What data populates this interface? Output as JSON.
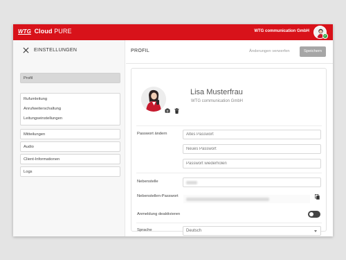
{
  "topbar": {
    "logo_brand": "WTG",
    "logo_product": "Cloud",
    "logo_edition": "PURE",
    "company": "WTG communication GmbH",
    "status_mark": "✓"
  },
  "sidebar": {
    "title": "EINSTELLUNGEN",
    "items": [
      {
        "label": "Profil",
        "active": true
      },
      {
        "label": "Rufumleitung"
      },
      {
        "label": "Anrufweiterschaltung"
      },
      {
        "label": "Leitungseinstellungen"
      },
      {
        "label": "Mitteilungen"
      },
      {
        "label": "Audio"
      },
      {
        "label": "Client-Informationen"
      },
      {
        "label": "Logs"
      }
    ]
  },
  "main": {
    "title": "PROFIL",
    "discard_label": "Änderungen verwerfen",
    "save_label": "Speichern",
    "profile": {
      "name": "Lisa Musterfrau",
      "company": "WTG communication GmbH"
    },
    "password": {
      "label": "Passwort ändern",
      "old_placeholder": "Altes Passwort",
      "new_placeholder": "Neues Passwort",
      "repeat_placeholder": "Passwort wiederholen"
    },
    "extension": {
      "label": "Nebenstelle"
    },
    "extension_password": {
      "label": "Nebenstellen-Passwort"
    },
    "disable_login": {
      "label": "Anmeldung deaktivieren",
      "enabled": false
    },
    "language": {
      "label": "Sprache",
      "value": "Deutsch"
    }
  },
  "colors": {
    "brand_red": "#d8121a",
    "status_green": "#3aa845",
    "save_button": "#a6a6a6"
  }
}
